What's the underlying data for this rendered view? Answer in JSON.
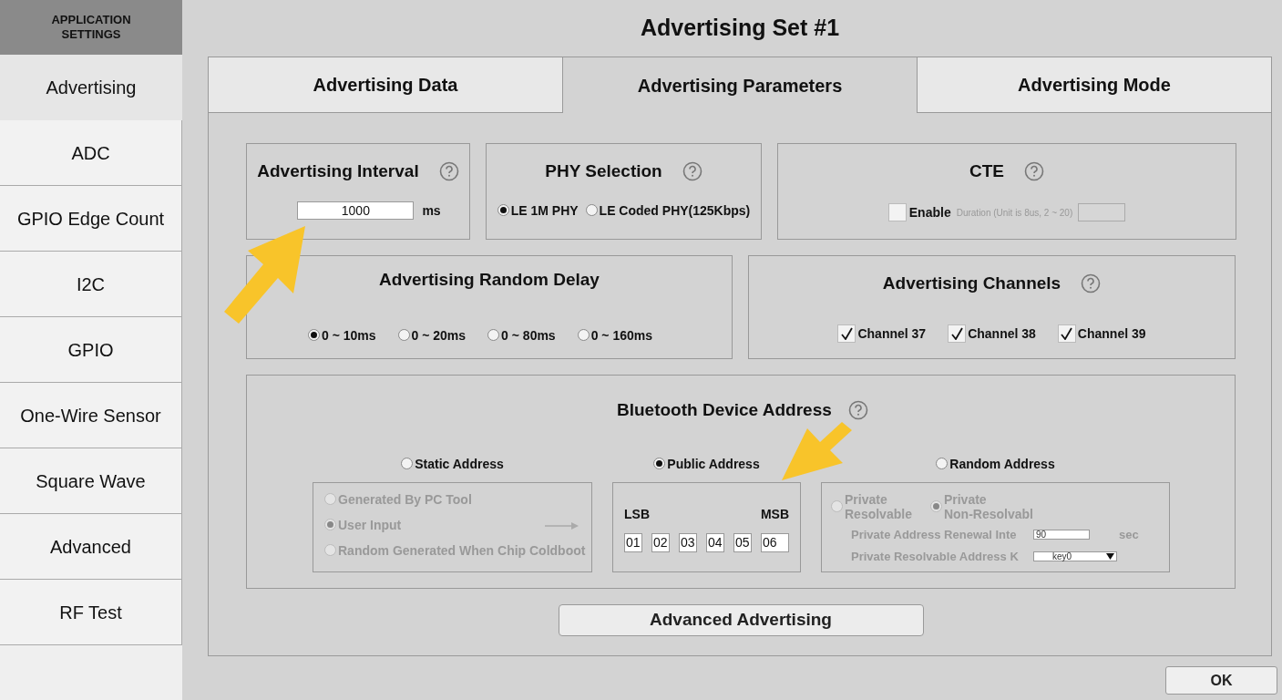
{
  "sidebar": {
    "header": "APPLICATION SETTINGS",
    "items": [
      {
        "label": "Advertising",
        "selected": true
      },
      {
        "label": "ADC",
        "selected": false
      },
      {
        "label": "GPIO Edge Count",
        "selected": false
      },
      {
        "label": "I2C",
        "selected": false
      },
      {
        "label": "GPIO",
        "selected": false
      },
      {
        "label": "One-Wire Sensor",
        "selected": false
      },
      {
        "label": "Square Wave",
        "selected": false
      },
      {
        "label": "Advanced",
        "selected": false
      },
      {
        "label": "RF Test",
        "selected": false
      }
    ]
  },
  "title": "Advertising Set #1",
  "tabs": [
    {
      "label": "Advertising Data",
      "selected": false
    },
    {
      "label": "Advertising Parameters",
      "selected": true
    },
    {
      "label": "Advertising Mode",
      "selected": false
    }
  ],
  "advertising_interval": {
    "title": "Advertising Interval",
    "value": "1000",
    "unit": "ms"
  },
  "phy_selection": {
    "title": "PHY Selection",
    "options": [
      {
        "label": "LE 1M PHY",
        "selected": true
      },
      {
        "label": "LE Coded PHY(125Kbps)",
        "selected": false
      }
    ]
  },
  "cte": {
    "title": "CTE",
    "enable": {
      "label": "Enable",
      "checked": false
    },
    "duration_label": "Duration (Unit is 8us, 2 ~ 20)"
  },
  "random_delay": {
    "title": "Advertising Random Delay",
    "options": [
      {
        "label": "0 ~ 10ms",
        "selected": true
      },
      {
        "label": "0 ~ 20ms",
        "selected": false
      },
      {
        "label": "0 ~ 80ms",
        "selected": false
      },
      {
        "label": "0 ~ 160ms",
        "selected": false
      }
    ]
  },
  "channels": {
    "title": "Advertising Channels",
    "items": [
      {
        "label": "Channel 37",
        "checked": true
      },
      {
        "label": "Channel 38",
        "checked": true
      },
      {
        "label": "Channel 39",
        "checked": true
      }
    ]
  },
  "device_address": {
    "title": "Bluetooth Device Address",
    "options": [
      {
        "label": "Static Address",
        "selected": false
      },
      {
        "label": "Public Address",
        "selected": true
      },
      {
        "label": "Random Address",
        "selected": false
      }
    ],
    "static": {
      "disabled": true,
      "options": [
        {
          "label": "Generated By PC Tool",
          "selected": false
        },
        {
          "label": "User Input",
          "selected": true
        },
        {
          "label": "Random Generated When Chip Coldboot",
          "selected": false
        }
      ]
    },
    "public": {
      "lsb": "LSB",
      "msb": "MSB",
      "bytes": [
        "01",
        "02",
        "03",
        "04",
        "05",
        "06"
      ]
    },
    "random": {
      "disabled": true,
      "options": [
        {
          "label": "Private\nResolvable",
          "selected": false
        },
        {
          "label": "Private\nNon-Resolvabl",
          "selected": true
        }
      ],
      "renewal_label": "Private Address Renewal Inte",
      "renewal_value": "90",
      "unit": "sec",
      "key_label": "Private Resolvable Address K",
      "key_value": "key0"
    }
  },
  "advanced_button": "Advanced Advertising",
  "ok_button": "OK"
}
